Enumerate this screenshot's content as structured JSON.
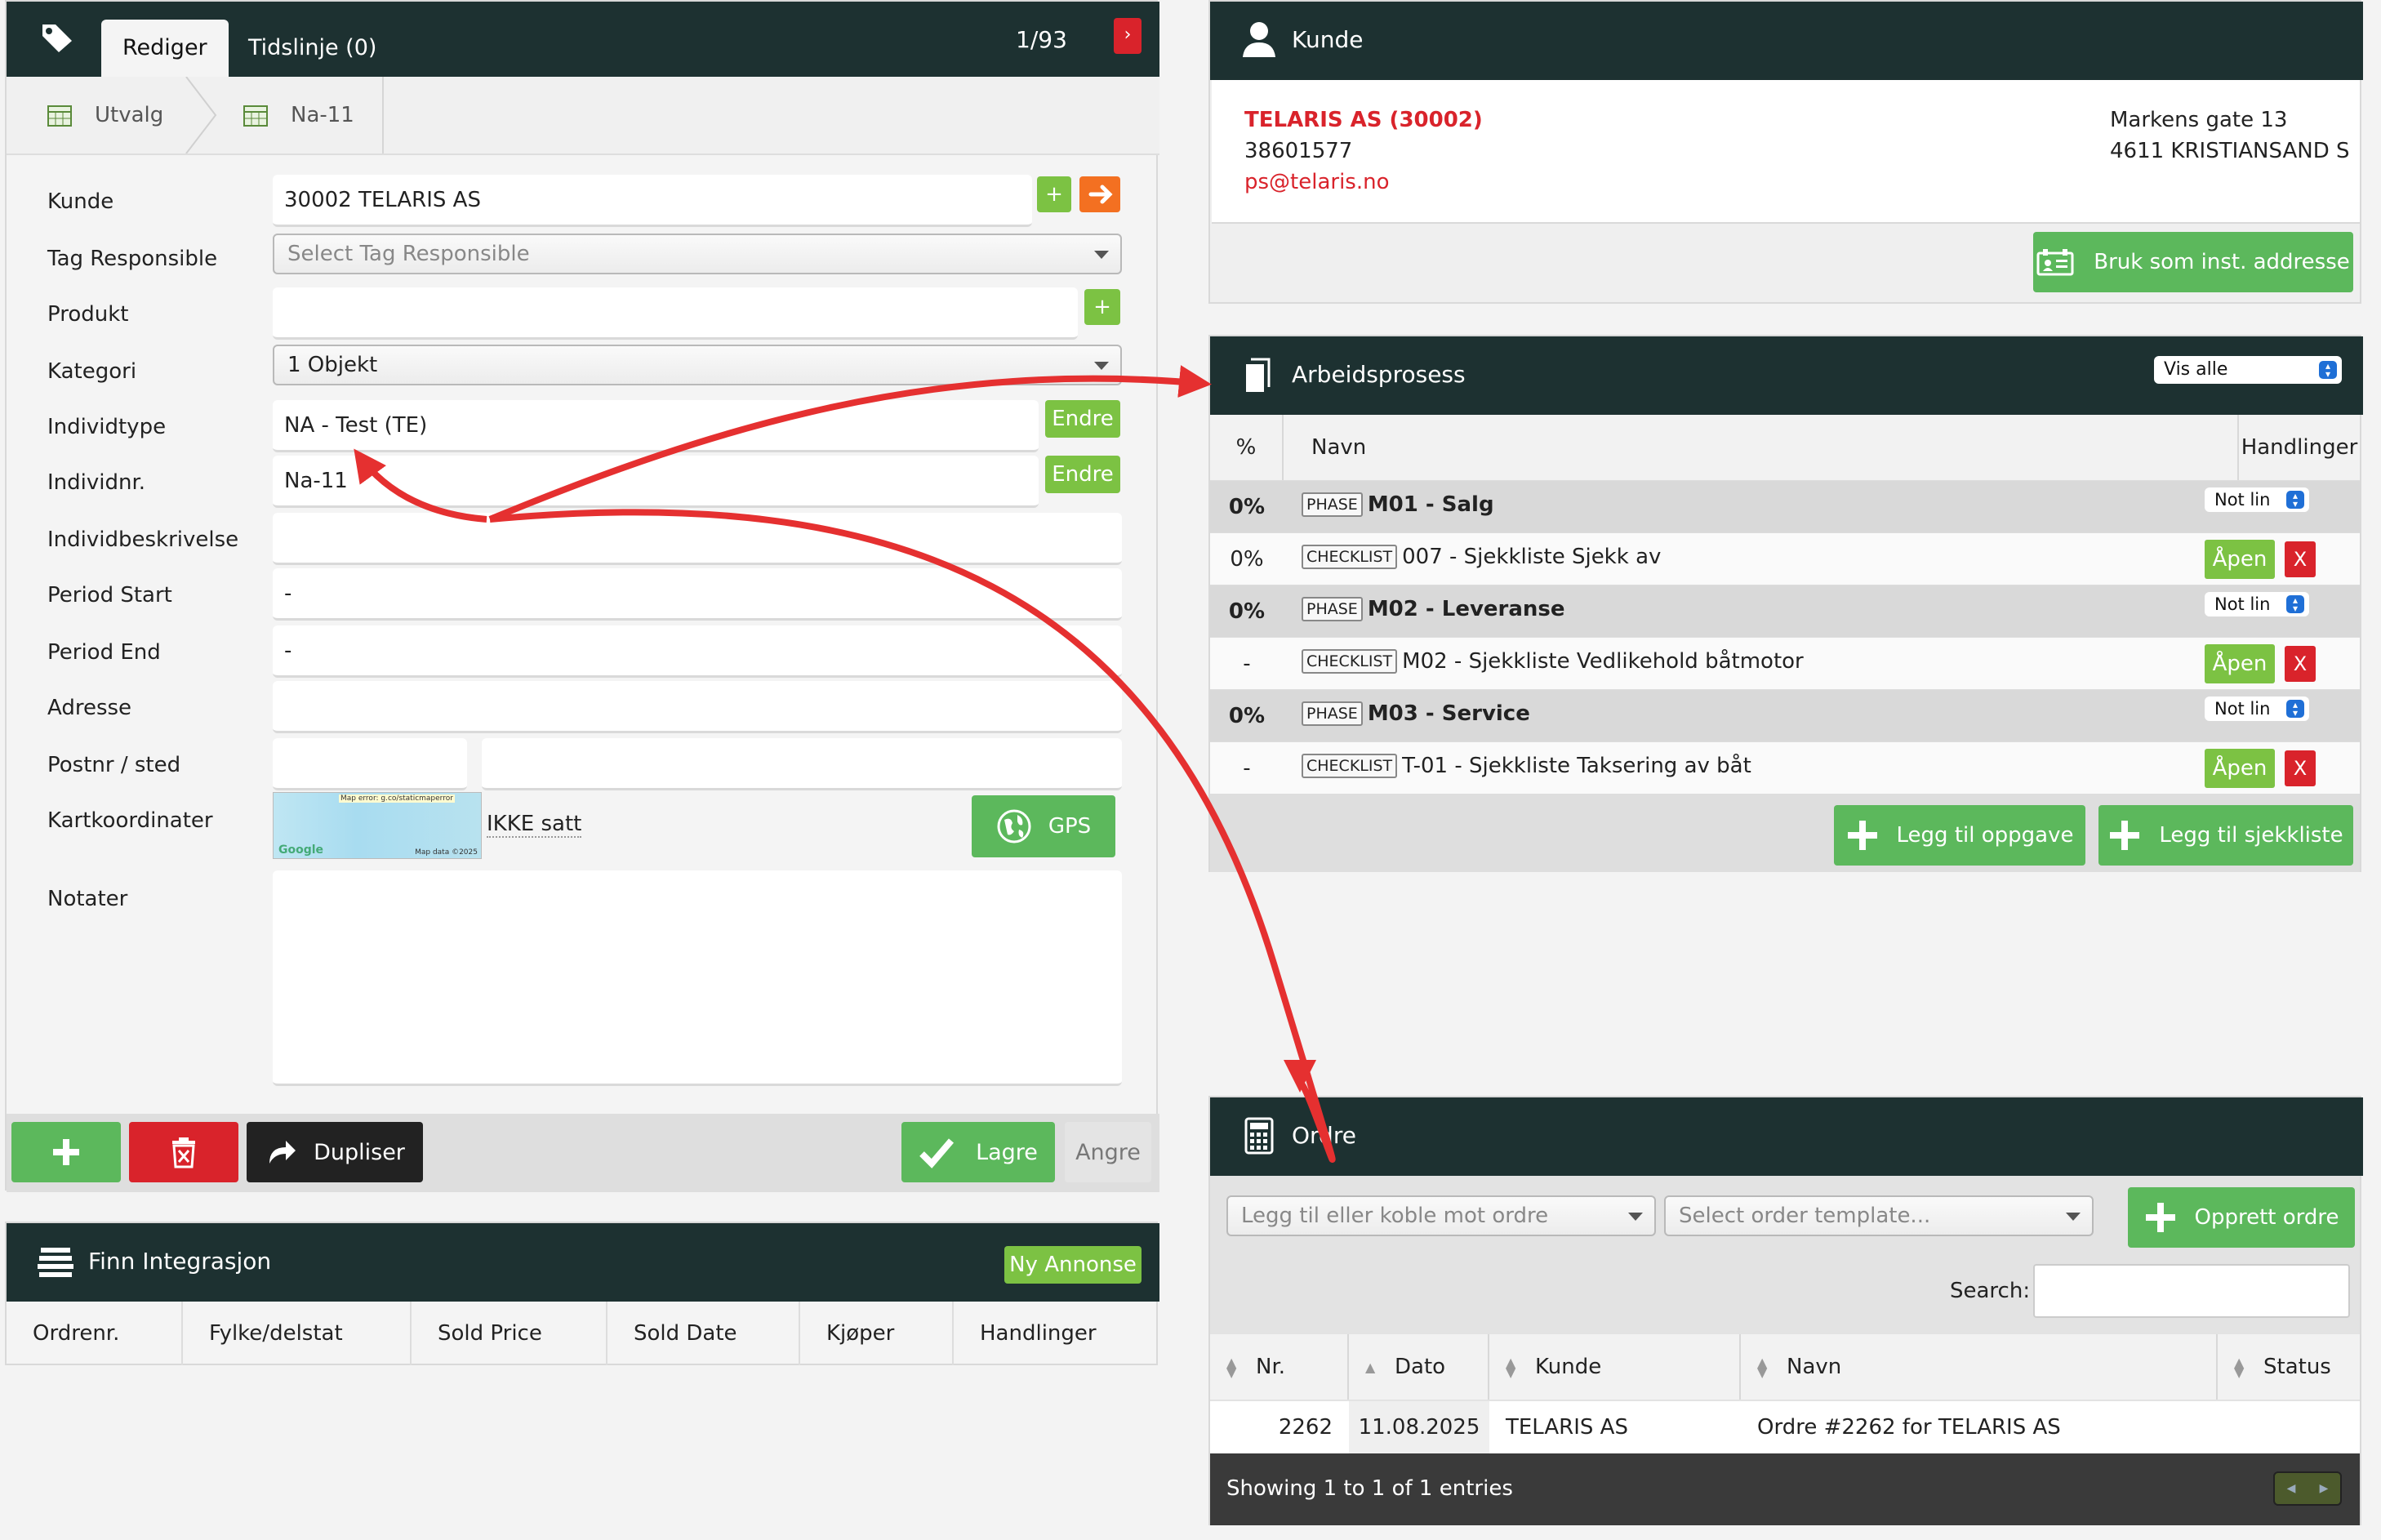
{
  "colors": {
    "header_bg": "#1d3131",
    "accent_green": "#5cb85c",
    "light_green": "#7cc243",
    "danger_red": "#d9232b",
    "link_red": "#d9232b",
    "orange": "#f37021",
    "annotation_arrow": "#e53030"
  },
  "edit": {
    "tabs": [
      {
        "label": "Rediger"
      },
      {
        "label": "Tidslinje (0)"
      }
    ],
    "counter": "1/93",
    "next_icon": "›",
    "breadcrumbs": [
      "Utvalg",
      "Na-11"
    ],
    "fields": {
      "kunde": {
        "label": "Kunde",
        "value": "30002 TELARIS AS"
      },
      "tag_responsible": {
        "label": "Tag Responsible",
        "placeholder": "Select Tag Responsible"
      },
      "produkt": {
        "label": "Produkt",
        "value": ""
      },
      "kategori": {
        "label": "Kategori",
        "value": "1 Objekt"
      },
      "individtype": {
        "label": "Individtype",
        "value": "NA - Test (TE)",
        "button": "Endre"
      },
      "individnr": {
        "label": "Individnr.",
        "value": "Na-11",
        "button": "Endre"
      },
      "individbeskrivelse": {
        "label": "Individbeskrivelse",
        "value": ""
      },
      "period_start": {
        "label": "Period Start",
        "value": "-"
      },
      "period_end": {
        "label": "Period End",
        "value": "-"
      },
      "adresse": {
        "label": "Adresse",
        "value": ""
      },
      "postnr_sted": {
        "label": "Postnr / sted",
        "postnr": "",
        "sted": ""
      },
      "kartkoordinater": {
        "label": "Kartkoordinater",
        "status": "IKKE satt",
        "map_error": "Map error: g.co/staticmaperror",
        "map_brand": "Google",
        "map_data": "Map data ©2025",
        "gps_label": "GPS"
      },
      "notater": {
        "label": "Notater",
        "value": ""
      }
    },
    "footer": {
      "duplicate_label": "Dupliser",
      "save_label": "Lagre",
      "cancel_label": "Angre"
    }
  },
  "finn": {
    "title": "Finn Integrasjon",
    "new_ad_label": "Ny Annonse",
    "columns": [
      "Ordrenr.",
      "Fylke/delstat",
      "Sold Price",
      "Sold Date",
      "Kjøper",
      "Handlinger"
    ]
  },
  "kunde": {
    "title": "Kunde",
    "name": "TELARIS AS (30002)",
    "phone": "38601577",
    "email": "ps@telaris.no",
    "address_line1": "Markens gate 13",
    "address_line2": "4611 KRISTIANSAND S",
    "use_address_label": "Bruk som inst. addresse"
  },
  "arbeid": {
    "title": "Arbeidsprosess",
    "filter_value": "Vis alle",
    "columns": {
      "pct": "%",
      "name": "Navn",
      "actions": "Handlinger"
    },
    "rows": [
      {
        "kind": "phase",
        "pct": "0%",
        "tag": "PHASE",
        "name": "M01 - Salg",
        "action": "Not lin"
      },
      {
        "kind": "check",
        "pct": "0%",
        "tag": "CHECKLIST",
        "name": "007 - Sjekkliste Sjekk av",
        "action": "Åpen",
        "delete": "X"
      },
      {
        "kind": "phase",
        "pct": "0%",
        "tag": "PHASE",
        "name": "M02 - Leveranse",
        "action": "Not lin"
      },
      {
        "kind": "check",
        "pct": "-",
        "tag": "CHECKLIST",
        "name": "M02 - Sjekkliste Vedlikehold båtmotor",
        "action": "Åpen",
        "delete": "X"
      },
      {
        "kind": "phase",
        "pct": "0%",
        "tag": "PHASE",
        "name": "M03 - Service",
        "action": "Not lin"
      },
      {
        "kind": "check",
        "pct": "-",
        "tag": "CHECKLIST",
        "name": "T-01 - Sjekkliste Taksering av båt",
        "action": "Åpen",
        "delete": "X"
      }
    ],
    "add_task_label": "Legg til oppgave",
    "add_checklist_label": "Legg til sjekkliste"
  },
  "ordre": {
    "title": "Ordre",
    "link_placeholder": "Legg til eller koble mot ordre",
    "template_placeholder": "Select order template...",
    "create_label": "Opprett ordre",
    "search_label": "Search:",
    "columns": [
      "Nr.",
      "Dato",
      "Kunde",
      "Navn",
      "Status"
    ],
    "row": {
      "nr": "2262",
      "dato": "11.08.2025",
      "kunde": "TELARIS AS",
      "navn": "Ordre #2262 for TELARIS AS",
      "status": ""
    },
    "showing": "Showing 1 to 1 of 1 entries"
  }
}
